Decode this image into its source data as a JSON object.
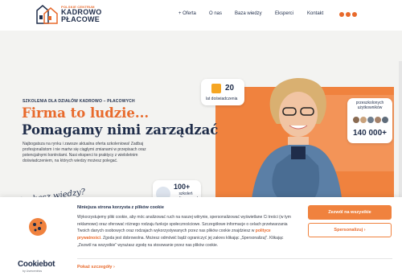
{
  "header": {
    "logo": {
      "line1": "POLSKIE CENTRUM",
      "line2": "KADROWO",
      "line3": "PŁACOWE"
    },
    "nav": [
      "+ Oferta",
      "O nas",
      "Baza wiedzy",
      "Eksperci",
      "Kontakt"
    ],
    "social_icons": [
      "facebook-icon",
      "linkedin-icon",
      "instagram-icon"
    ]
  },
  "hero": {
    "eyebrow": "SZKOLENIA DLA DZIAŁÓW KADROWO – PŁACOWYCH",
    "title_line1": "Firma to ludzie...",
    "title_line2": "Pomagamy nimi zarządzać",
    "description": "Najbogatsza na rynku i zawsze aktualna oferta szkoleniowa! Zadbaj profesjonalistom i nie martw się ciągłymi zmianami w przepisach oraz potencjalnymi kontrolami. Nasi eksperci to praktycy z wieloletnim doświadczeniem, na których wiedzy możesz polegać.",
    "handwritten": "Szukasz wiedzy?",
    "badge_years": {
      "value": "20",
      "label": "lat doświadczenia"
    },
    "badge_users": {
      "label": "przeszkolonych użytkowników",
      "value": "140 000+"
    },
    "badge_trainings": {
      "value": "100+",
      "label": "szkoleń realizowanych miesięcznie"
    }
  },
  "cookie": {
    "title": "Niniejsza strona korzysta z plików cookie",
    "text_before": "Wykorzystujemy pliki cookie, aby móc analizować ruch na naszej witrynie, spersonalizować wyświetlane Ci treści (w tym reklamowe) oraz oferować różnego rodzaju funkcje społecznościowe. Szczegółowe informacje o celach przetwarzania Twoich danych osobowych oraz rodzajach wykorzystywanych przez nas plików cookie znajdziesz w ",
    "link": "polityce prywatności",
    "text_after": ". Zgoda jest dobrowolna. Możesz odmówić bądź ograniczyć jej zakres klikając „Spersonalizuj\". Klikając „Zezwól na wszystkie\" wyrażasz zgodę na stosowanie przez nas plików cookie.",
    "details": "Pokaż szczegóły",
    "allow_all": "Zezwól na wszystkie",
    "customize": "Spersonalizuj",
    "brand": "Cookiebot",
    "brand_sub": "by Usercentrics"
  },
  "colors": {
    "accent": "#e86a2c",
    "navy": "#1f2d4a",
    "hero_bg": "#f3f3f1"
  }
}
